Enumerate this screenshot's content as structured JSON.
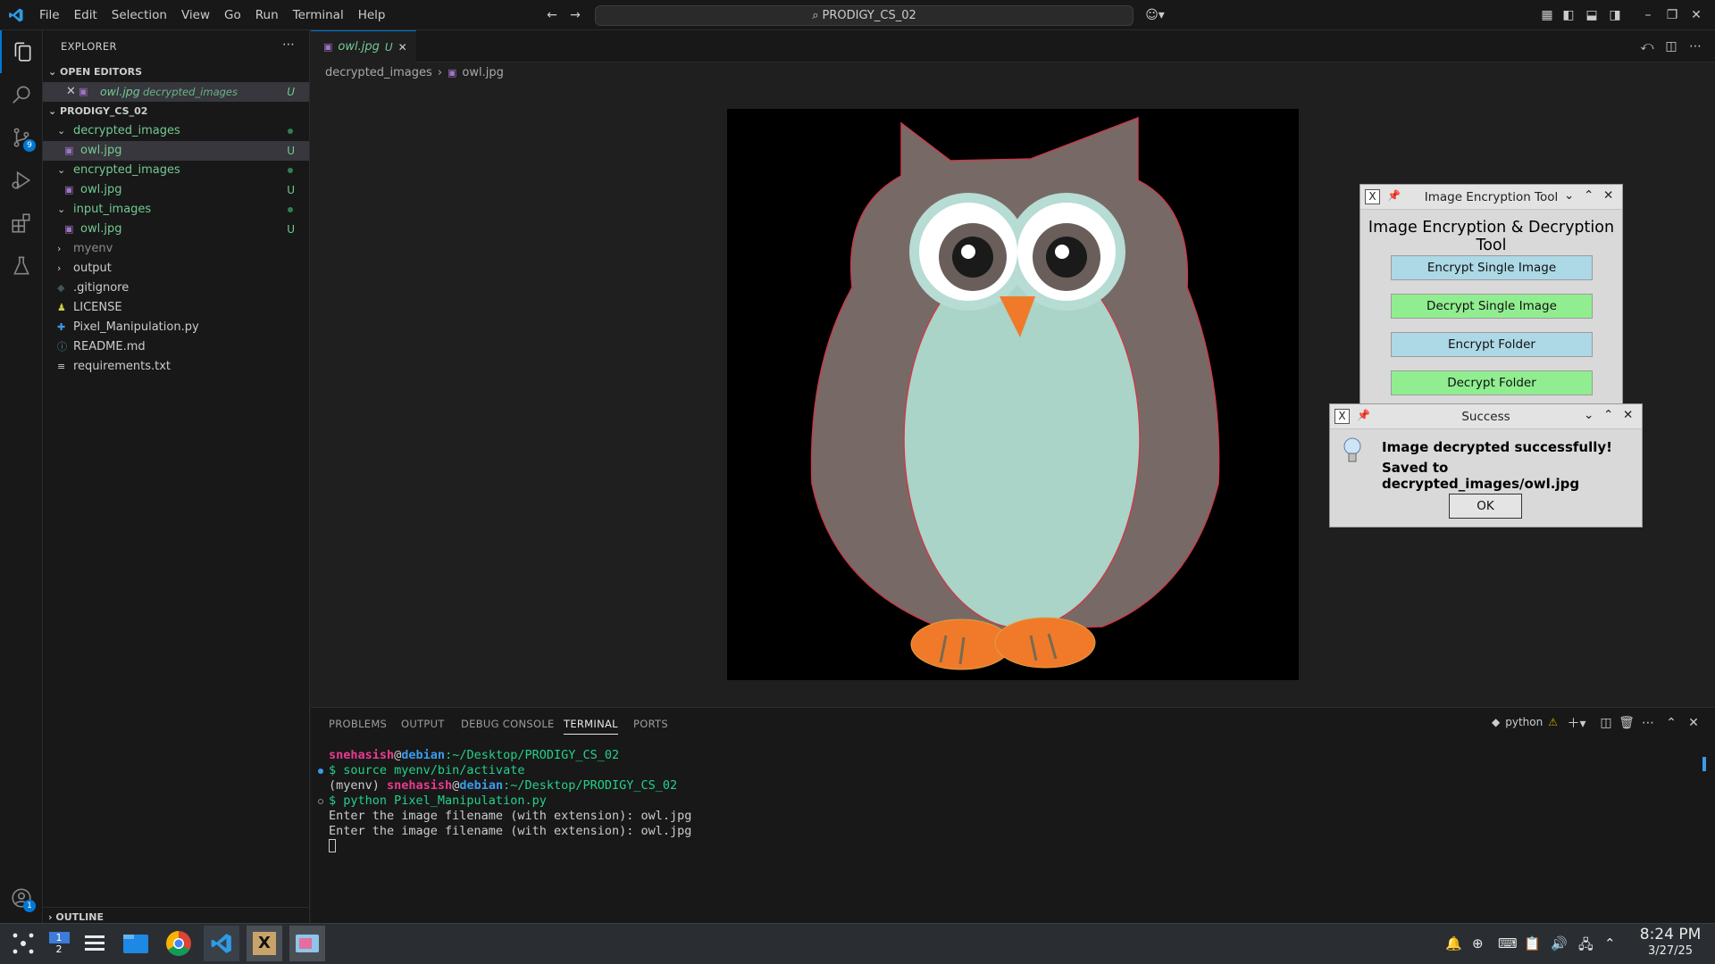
{
  "menu": [
    "File",
    "Edit",
    "Selection",
    "View",
    "Go",
    "Run",
    "Terminal",
    "Help"
  ],
  "search_text": "PRODIGY_CS_02",
  "activity": {
    "scm_badge": "9",
    "account_badge": "1"
  },
  "explorer": {
    "title": "EXPLORER",
    "open_editors_label": "OPEN EDITORS",
    "open_editor": {
      "name": "owl.jpg",
      "folder": "decrypted_images",
      "status": "U"
    },
    "project_label": "PRODIGY_CS_02",
    "tree": [
      {
        "label": "decrypted_images",
        "type": "folder"
      },
      {
        "label": "owl.jpg",
        "type": "file",
        "status": "U"
      },
      {
        "label": "encrypted_images",
        "type": "folder"
      },
      {
        "label": "owl.jpg",
        "type": "file",
        "status": "U"
      },
      {
        "label": "input_images",
        "type": "folder"
      },
      {
        "label": "owl.jpg",
        "type": "file",
        "status": "U"
      },
      {
        "label": "myenv",
        "type": "folder"
      },
      {
        "label": "output",
        "type": "folder"
      },
      {
        "label": ".gitignore",
        "type": "file"
      },
      {
        "label": "LICENSE",
        "type": "file"
      },
      {
        "label": "Pixel_Manipulation.py",
        "type": "file"
      },
      {
        "label": "README.md",
        "type": "file"
      },
      {
        "label": "requirements.txt",
        "type": "file"
      }
    ],
    "outline_label": "OUTLINE"
  },
  "editor": {
    "tab_label": "owl.jpg",
    "tab_status": "U",
    "breadcrumb": [
      "decrypted_images",
      "owl.jpg"
    ]
  },
  "panel": {
    "tabs": [
      "PROBLEMS",
      "OUTPUT",
      "DEBUG CONSOLE",
      "TERMINAL",
      "PORTS"
    ],
    "shell_label": "python",
    "terminal": {
      "user": "snehasish",
      "host": "debian",
      "path": ":~/Desktop/PRODIGY_CS_02",
      "cmd1": "$ source myenv/bin/activate",
      "env": "(myenv) ",
      "cmd2": "$ python Pixel_Manipulation.py",
      "out1": "Enter the image filename (with extension): owl.jpg",
      "out2": "Enter the image filename (with extension): owl.jpg"
    }
  },
  "tool_window": {
    "title": "Image Encryption Tool",
    "heading": "Image Encryption & Decryption Tool",
    "buttons": [
      "Encrypt Single Image",
      "Decrypt Single Image",
      "Encrypt Folder",
      "Decrypt Folder"
    ],
    "colors": {
      "encrypt": "#add8e6",
      "decrypt": "#90ee90"
    }
  },
  "success_dialog": {
    "title": "Success",
    "line1": "Image decrypted successfully!",
    "line2": "Saved to decrypted_images/owl.jpg",
    "ok": "OK"
  },
  "taskbar": {
    "pager": [
      "1",
      "2"
    ],
    "time": "8:24 PM",
    "date": "3/27/25"
  },
  "accent": "#0078d4"
}
